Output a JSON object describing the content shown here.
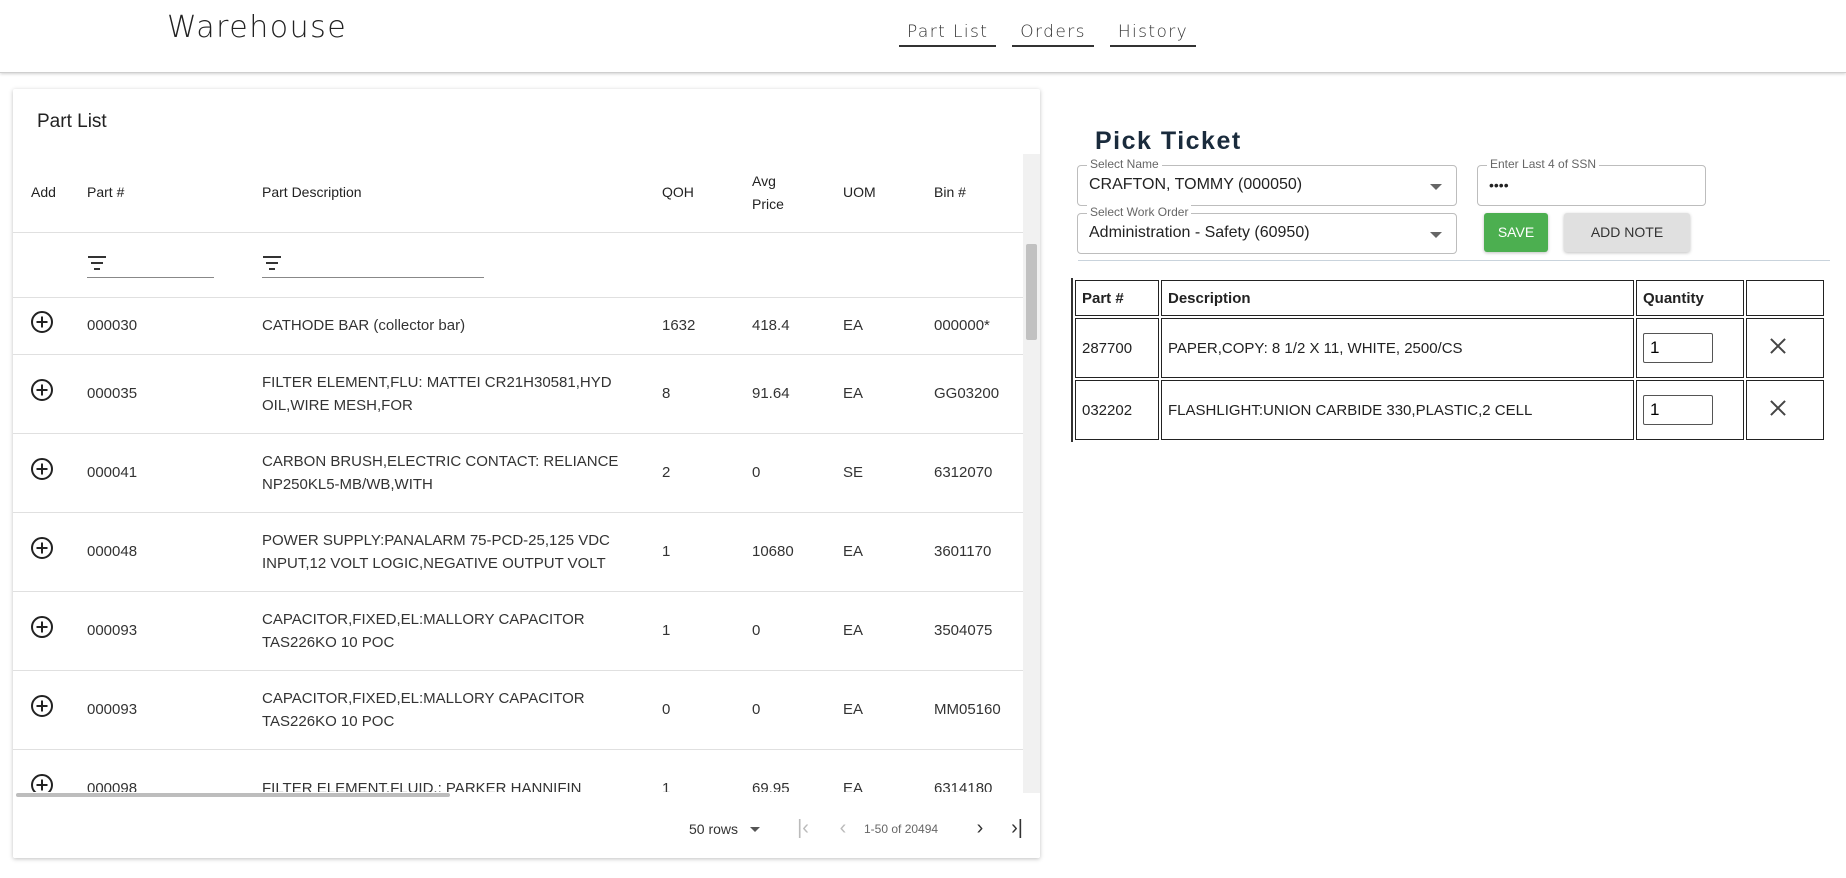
{
  "header": {
    "brand": "Warehouse",
    "nav": [
      "Part List",
      "Orders",
      "History"
    ]
  },
  "part_list": {
    "title": "Part List",
    "columns": [
      "Add",
      "Part #",
      "Part Description",
      "QOH",
      "Avg Price",
      "UOM",
      "Bin #"
    ],
    "rows": [
      {
        "part": "000030",
        "desc": "CATHODE BAR (collector bar)",
        "qoh": "1632",
        "price": "418.4",
        "uom": "EA",
        "bin": "000000*"
      },
      {
        "part": "000035",
        "desc": "FILTER ELEMENT,FLU: MATTEI CR21H30581,HYD OIL,WIRE MESH,FOR",
        "qoh": "8",
        "price": "91.64",
        "uom": "EA",
        "bin": "GG03200"
      },
      {
        "part": "000041",
        "desc": "CARBON BRUSH,ELECTRIC CONTACT: RELIANCE NP250KL5-MB/WB,WITH",
        "qoh": "2",
        "price": "0",
        "uom": "SE",
        "bin": "6312070"
      },
      {
        "part": "000048",
        "desc": "POWER SUPPLY:PANALARM 75-PCD-25,125 VDC INPUT,12 VOLT LOGIC,NEGATIVE OUTPUT VOLT",
        "qoh": "1",
        "price": "10680",
        "uom": "EA",
        "bin": "3601170"
      },
      {
        "part": "000093",
        "desc": "CAPACITOR,FIXED,EL:MALLORY CAPACITOR TAS226KO 10 POC",
        "qoh": "1",
        "price": "0",
        "uom": "EA",
        "bin": "3504075"
      },
      {
        "part": "000093",
        "desc": "CAPACITOR,FIXED,EL:MALLORY CAPACITOR TAS226KO 10 POC",
        "qoh": "0",
        "price": "0",
        "uom": "EA",
        "bin": "MM05160"
      },
      {
        "part": "000098",
        "desc": "FILTER ELEMENT,FLUID,: PARKER HANNIFIN",
        "qoh": "1",
        "price": "69.95",
        "uom": "EA",
        "bin": "6314180"
      }
    ],
    "footer": {
      "rows_per_page": "50 rows",
      "range": "1-50 of 20494"
    }
  },
  "pick_ticket": {
    "title": "Pick Ticket",
    "name_label": "Select Name",
    "name_value": "CRAFTON, TOMMY (000050)",
    "ssn_label": "Enter Last 4 of SSN",
    "ssn_value": "••••",
    "work_order_label": "Select Work Order",
    "work_order_value": "Administration - Safety (60950)",
    "save_label": "SAVE",
    "add_note_label": "ADD NOTE",
    "columns": [
      "Part #",
      "Description",
      "Quantity",
      ""
    ],
    "items": [
      {
        "part": "287700",
        "desc": "PAPER,COPY: 8 1/2 X 11, WHITE, 2500/CS",
        "qty": "1"
      },
      {
        "part": "032202",
        "desc": "FLASHLIGHT:UNION CARBIDE 330,PLASTIC,2 CELL",
        "qty": "1"
      }
    ]
  },
  "colors": {
    "save_button": "#4caf50",
    "add_note_button": "#e0e0e0",
    "pick_title": "#1a2b3c"
  },
  "icons": {
    "add": "plus-circle-icon",
    "filter": "filter-icon",
    "remove": "close-icon",
    "first_page": "first-page-icon",
    "prev_page": "chevron-left-icon",
    "next_page": "chevron-right-icon",
    "last_page": "last-page-icon",
    "dropdown": "caret-down-icon"
  }
}
